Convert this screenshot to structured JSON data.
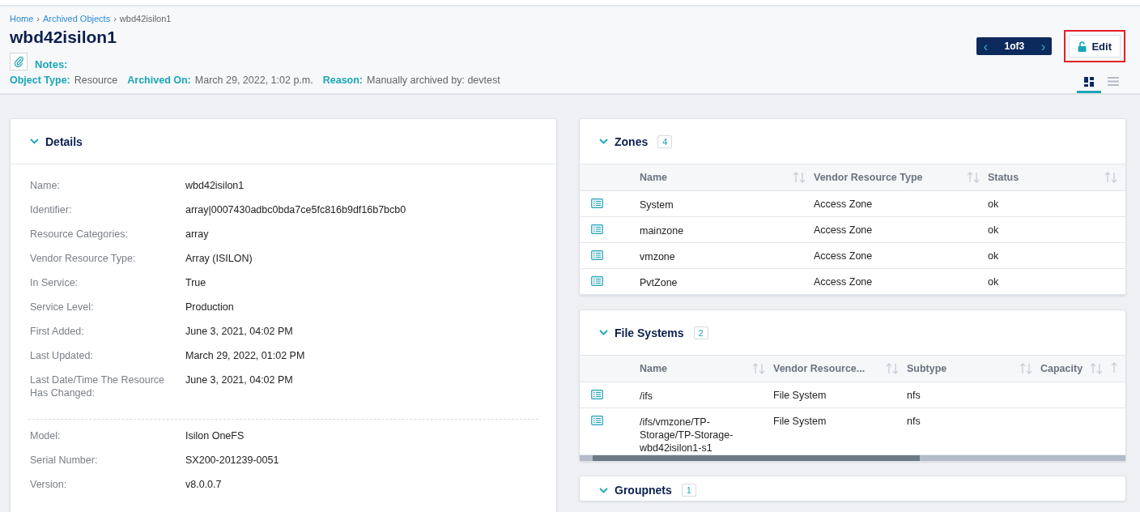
{
  "breadcrumb": [
    {
      "label": "Home",
      "link": true
    },
    {
      "label": "Archived Objects",
      "link": true
    },
    {
      "label": "wbd42isilon1",
      "link": false
    }
  ],
  "breadcrumb_separator": "›",
  "title": "wbd42isilon1",
  "pager": {
    "prev": "‹",
    "text": "1of3",
    "next": "›"
  },
  "edit_button": {
    "label": "Edit",
    "highlighted": true
  },
  "notes_label": "Notes:",
  "meta": [
    {
      "label": "Object Type:",
      "value": "Resource"
    },
    {
      "label": "Archived On:",
      "value": "March 29, 2022, 1:02 p.m."
    },
    {
      "label": "Reason:",
      "value": "Manually archived by: devtest"
    }
  ],
  "view_toggle": [
    {
      "kind": "grid",
      "selected": true
    },
    {
      "kind": "list",
      "selected": false
    }
  ],
  "details": {
    "title": "Details",
    "expanded": true,
    "sections": [
      [
        {
          "label": "Name:",
          "value": "wbd42isilon1"
        },
        {
          "label": "Identifier:",
          "value": "array|0007430adbc0bda7ce5fc816b9df16b7bcb0"
        },
        {
          "label": "Resource Categories:",
          "value": "array"
        },
        {
          "label": "Vendor Resource Type:",
          "value": "Array (ISILON)"
        },
        {
          "label": "In Service:",
          "value": "True"
        },
        {
          "label": "Service Level:",
          "value": "Production"
        },
        {
          "label": "First Added:",
          "value": "June 3, 2021, 04:02 PM"
        },
        {
          "label": "Last Updated:",
          "value": "March 29, 2022, 01:02 PM"
        },
        {
          "label": "Last Date/Time The Resource Has Changed:",
          "value": "June 3, 2021, 04:02 PM"
        }
      ],
      [
        {
          "label": "Model:",
          "value": "Isilon OneFS"
        },
        {
          "label": "Serial Number:",
          "value": "SX200-201239-0051"
        },
        {
          "label": "Version:",
          "value": "v8.0.0.7"
        }
      ]
    ]
  },
  "zones": {
    "title": "Zones",
    "count": "4",
    "expanded": true,
    "columns": [
      "Name",
      "Vendor Resource Type",
      "Status"
    ],
    "rows": [
      [
        "System",
        "Access Zone",
        "ok"
      ],
      [
        "mainzone",
        "Access Zone",
        "ok"
      ],
      [
        "vmzone",
        "Access Zone",
        "ok"
      ],
      [
        "PvtZone",
        "Access Zone",
        "ok"
      ]
    ]
  },
  "file_systems": {
    "title": "File Systems",
    "count": "2",
    "expanded": true,
    "columns": [
      "Name",
      "Vendor Resource...",
      "Subtype",
      "Capacity"
    ],
    "rows": [
      [
        "/ifs",
        "File System",
        "nfs",
        ""
      ],
      [
        "/ifs/vmzone/TP-Storage/TP-Storage-wbd42isilon1-s1",
        "File System",
        "nfs",
        ""
      ]
    ]
  },
  "groupnets": {
    "title": "Groupnets",
    "count": "1",
    "expanded": true
  }
}
